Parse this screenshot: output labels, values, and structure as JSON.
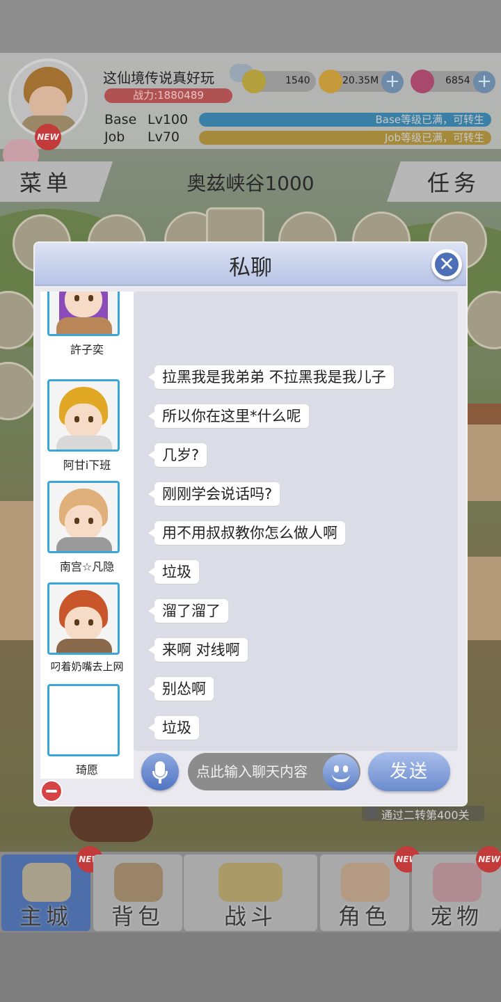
{
  "player": {
    "name": "这仙境传说真好玩",
    "power": "战力:1880489",
    "new_badge": "NEW"
  },
  "resources": [
    {
      "icon": "zeny-coin-icon",
      "value": "1540"
    },
    {
      "icon": "gold-coin-icon",
      "value": "20.35M"
    },
    {
      "icon": "gem-icon",
      "value": "6854"
    }
  ],
  "levels": {
    "base_label": "Base",
    "base_level": "Lv100",
    "base_status": "Base等级已满，可转生",
    "job_label": "Job",
    "job_level": "Lv70",
    "job_status": "Job等级已满，可转生"
  },
  "top_nav": {
    "menu": "菜单",
    "map_name": "奥兹峡谷1000",
    "task": "任务"
  },
  "dialog": {
    "title": "私聊",
    "close_icon": "close-x-icon"
  },
  "contacts": [
    {
      "name": "許子奕",
      "hair": "#8b4bb8"
    },
    {
      "name": "阿甘i下班",
      "hair": "#e0a824"
    },
    {
      "name": "南宫☆凡隐",
      "hair": "#e0b07a"
    },
    {
      "name": "叼着奶嘴去上网",
      "hair": "#c8562a"
    },
    {
      "name": "琦愿",
      "hair": ""
    }
  ],
  "messages": [
    "拉黑我是我弟弟 不拉黑我是我儿子",
    "所以你在这里*什么呢",
    "几岁?",
    "刚刚学会说话吗?",
    "用不用叔叔教你怎么做人啊",
    "垃圾",
    "溜了溜了",
    "来啊 对线啊",
    "别怂啊",
    "垃圾"
  ],
  "input": {
    "placeholder": "点此输入聊天内容",
    "send": "发送"
  },
  "background_text": {
    "notice": "通过二转第400关"
  },
  "bottom_nav": [
    {
      "label": "主城",
      "new": "NEW",
      "active": true
    },
    {
      "label": "背包",
      "new": "",
      "active": false
    },
    {
      "label": "战斗",
      "new": "",
      "active": false
    },
    {
      "label": "角色",
      "new": "NEW",
      "active": false
    },
    {
      "label": "宠物",
      "new": "NEW",
      "active": false
    }
  ],
  "colors": {
    "dialog_header": "#b7c4e6",
    "accent_blue": "#4c6fb8",
    "contact_border": "#3aa6d8",
    "power_red": "#b05252"
  }
}
